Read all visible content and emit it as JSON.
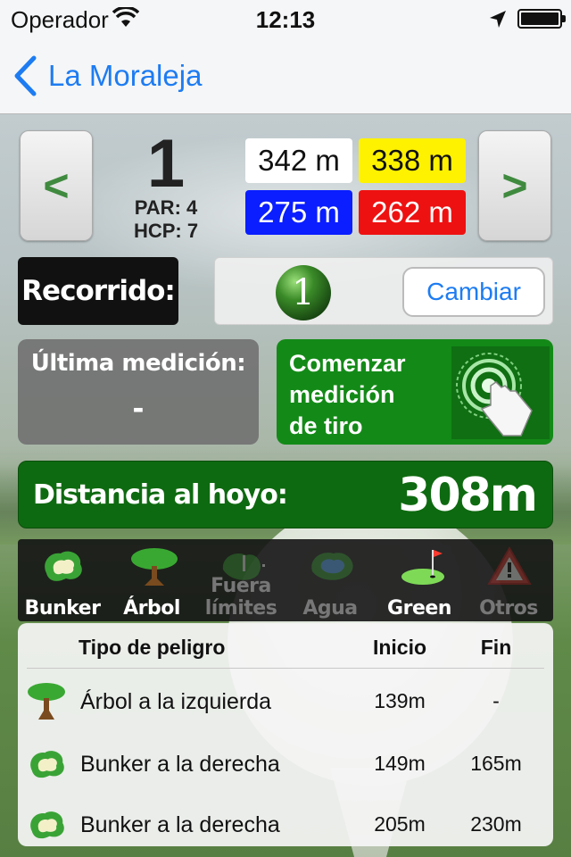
{
  "status_bar": {
    "carrier": "Operador",
    "time": "12:13"
  },
  "nav": {
    "back_label": "La Moraleja"
  },
  "hole": {
    "prev_label": "<",
    "next_label": ">",
    "number": "1",
    "par": "PAR: 4",
    "hcp": "HCP: 7",
    "tees": [
      {
        "value": "342 m",
        "bg": "#ffffff",
        "fg": "#111111"
      },
      {
        "value": "338 m",
        "bg": "#fff200",
        "fg": "#111111"
      },
      {
        "value": "275 m",
        "bg": "#0a1eff",
        "fg": "#ffffff"
      },
      {
        "value": "262 m",
        "bg": "#ee1111",
        "fg": "#ffffff"
      }
    ]
  },
  "route": {
    "label": "Recorrido:",
    "number": "1",
    "change_button": "Cambiar"
  },
  "last_measure": {
    "label": "Última medición:",
    "value": "-"
  },
  "start_shot": {
    "line1": "Comenzar",
    "line2": "medición",
    "line3": "de tiro"
  },
  "distance": {
    "label": "Distancia al hoyo:",
    "value": "308m"
  },
  "hazard_filters": [
    {
      "label": "Bunker",
      "icon": "bunker-icon",
      "active": true
    },
    {
      "label": "Árbol",
      "icon": "tree-icon",
      "active": true
    },
    {
      "label": "Fuera límites",
      "icon": "out-of-bounds-icon",
      "active": false
    },
    {
      "label": "Agua",
      "icon": "water-icon",
      "active": false
    },
    {
      "label": "Green",
      "icon": "green-flag-icon",
      "active": true
    },
    {
      "label": "Otros",
      "icon": "warning-icon",
      "active": false
    }
  ],
  "hazard_table": {
    "headers": {
      "type": "Tipo de peligro",
      "start": "Inicio",
      "end": "Fin"
    },
    "rows": [
      {
        "icon": "tree-icon",
        "name": "Árbol a la izquierda",
        "start": "139m",
        "end": "-"
      },
      {
        "icon": "bunker-icon",
        "name": "Bunker a la derecha",
        "start": "149m",
        "end": "165m"
      },
      {
        "icon": "bunker-icon",
        "name": "Bunker a la derecha",
        "start": "205m",
        "end": "230m"
      }
    ]
  },
  "colors": {
    "accent_blue": "#1d7cf2",
    "green_panel": "#138a17",
    "distance_green": "#0e6a10"
  }
}
